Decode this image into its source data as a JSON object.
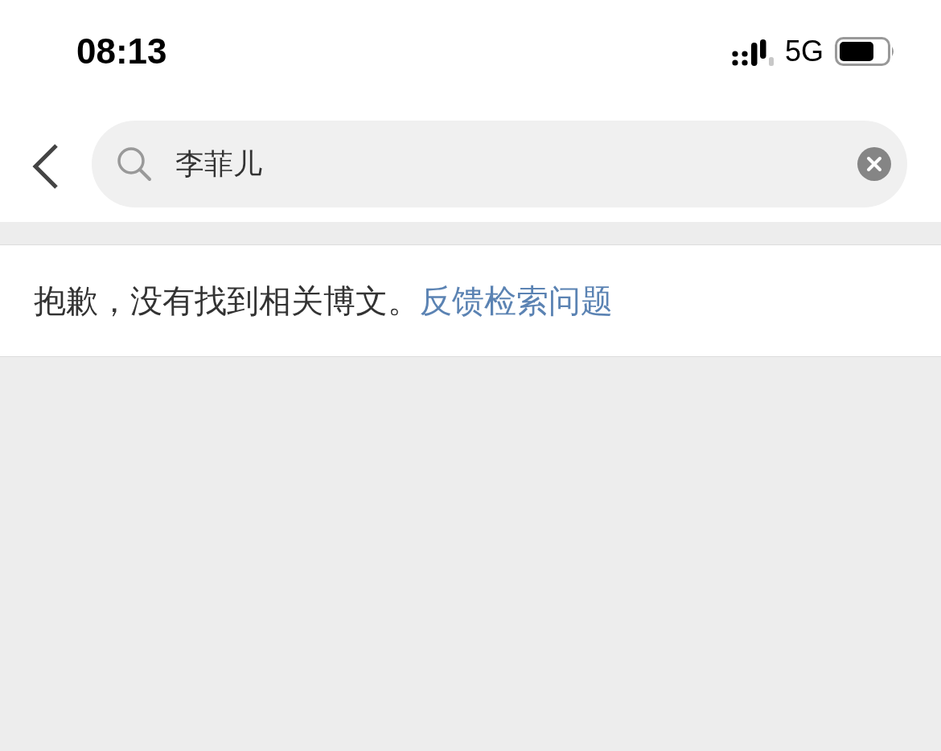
{
  "status_bar": {
    "time": "08:13",
    "network": "5G"
  },
  "search": {
    "value": "李菲儿"
  },
  "result": {
    "message": "抱歉，没有找到相关博文。",
    "link": "反馈检索问题"
  }
}
